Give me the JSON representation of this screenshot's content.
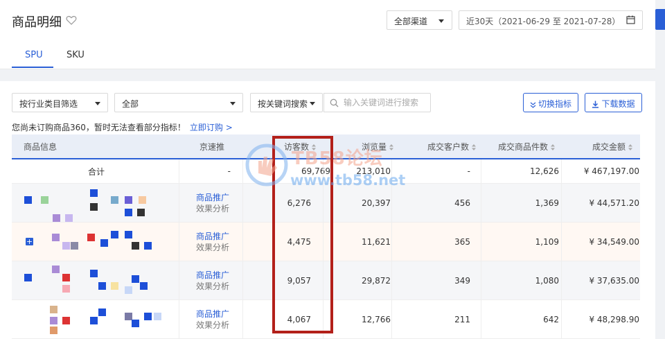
{
  "header": {
    "title": "商品明细",
    "channel_select": "全部渠道",
    "date_range": "近30天（2021-06-29 至 2021-07-28）",
    "tabs": [
      "SPU",
      "SKU"
    ],
    "active_tab": "SPU"
  },
  "filters": {
    "industry": "按行业类目筛选",
    "category": "全部",
    "keyword_mode": "按关键词搜索",
    "search_placeholder": "输入关键词进行搜索",
    "switch_metrics": "切换指标",
    "download": "下载数据"
  },
  "notice": {
    "text": "您尚未订购商品360，暂时无法查看部分指标！",
    "link": "立即订购 >"
  },
  "table": {
    "columns": [
      "商品信息",
      "京速推",
      "访客数",
      "浏览量",
      "成交客户数",
      "成交商品件数",
      "成交金额"
    ],
    "total": {
      "label": "合计",
      "jingsutui": "-",
      "visitors": "69,769",
      "pageviews": "213,010",
      "buyers": "-",
      "units": "12,626",
      "amount": "¥ 467,197.00"
    },
    "promo_link": "商品推广",
    "promo_sub": "效果分析",
    "rows": [
      {
        "visitors": "6,276",
        "pageviews": "20,397",
        "buyers": "456",
        "units": "1,369",
        "amount": "¥ 44,571.20"
      },
      {
        "visitors": "4,475",
        "pageviews": "11,621",
        "buyers": "365",
        "units": "1,109",
        "amount": "¥ 34,549.00"
      },
      {
        "visitors": "9,057",
        "pageviews": "29,872",
        "buyers": "349",
        "units": "1,080",
        "amount": "¥ 37,635.00"
      },
      {
        "visitors": "4,067",
        "pageviews": "12,766",
        "buyers": "211",
        "units": "642",
        "amount": "¥ 48,298.90"
      }
    ]
  },
  "watermark": {
    "title": "TB58论坛",
    "url": "www.tb58.net"
  },
  "colors": {
    "accent": "#2a5fd6",
    "highlight_box": "#b3201a"
  }
}
